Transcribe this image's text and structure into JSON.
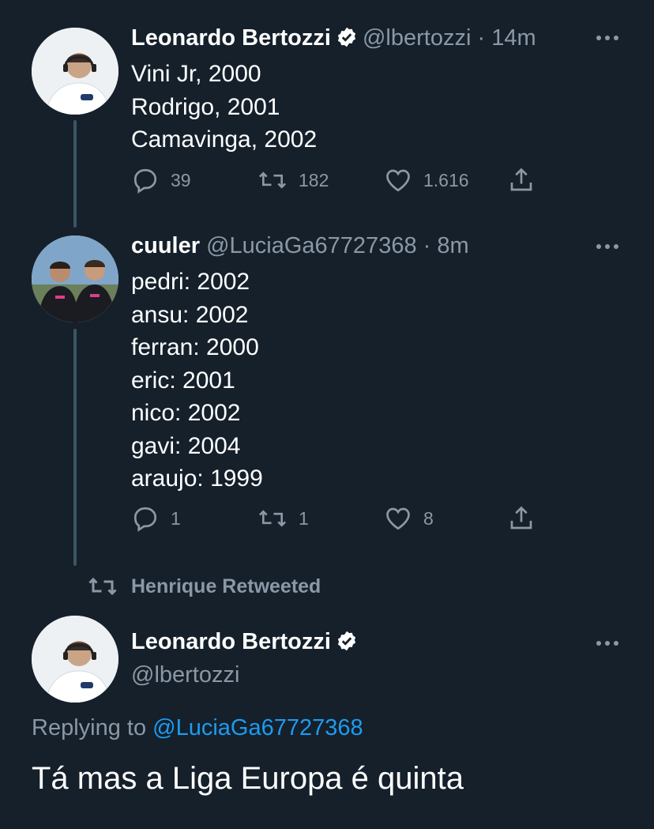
{
  "tweet1": {
    "name": "Leonardo Bertozzi",
    "handle": "@lbertozzi",
    "time": "14m",
    "lines": "Vini Jr, 2000\nRodrigo, 2001\nCamavinga, 2002",
    "replies": "39",
    "retweets": "182",
    "likes": "1.616"
  },
  "tweet2": {
    "name": "cuuler",
    "handle": "@LuciaGa67727368",
    "time": "8m",
    "lines": "pedri: 2002\nansu: 2002\nferran: 2000\neric: 2001\nnico: 2002\ngavi: 2004\naraujo: 1999",
    "replies": "1",
    "retweets": "1",
    "likes": "8"
  },
  "retweet_context": {
    "label": "Henrique Retweeted"
  },
  "main_tweet": {
    "name": "Leonardo Bertozzi",
    "handle": "@lbertozzi",
    "replying_prefix": "Replying to",
    "replying_handle": "@LuciaGa67727368",
    "text": "Tá mas a Liga Europa é quinta"
  },
  "icons": {
    "more": "more-horizontal-icon",
    "verified": "verified-badge-icon",
    "reply": "reply-icon",
    "retweet": "retweet-icon",
    "like": "like-icon",
    "share": "share-icon"
  },
  "colors": {
    "background": "#15202b",
    "text": "#ffffff",
    "muted": "#8b98a5",
    "link": "#1d9bf0",
    "thread_line": "#3d5466"
  }
}
